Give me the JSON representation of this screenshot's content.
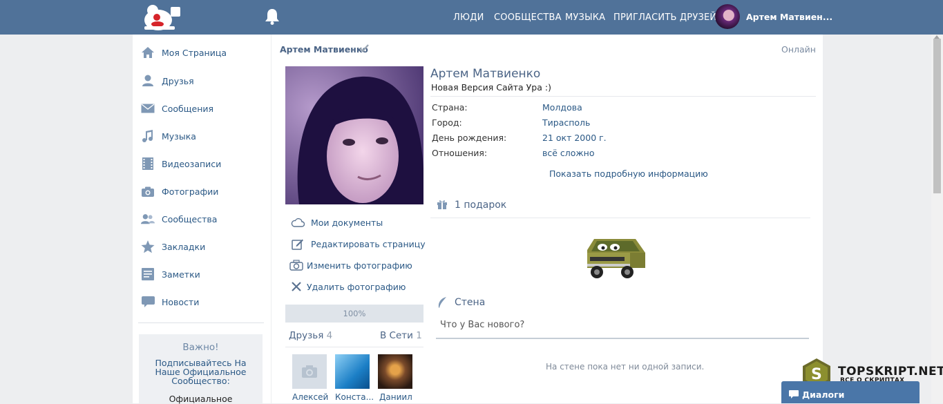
{
  "topbar": {
    "nav": [
      "ЛЮДИ",
      "СООБЩЕСТВА",
      "МУЗЫКА",
      "ПРИГЛАСИТЬ ДРУЗЕЙ"
    ],
    "username": "Артем Матвиен..."
  },
  "sidebar": {
    "items": [
      {
        "label": "Моя Страница",
        "icon": "home-icon"
      },
      {
        "label": "Друзья",
        "icon": "user-icon"
      },
      {
        "label": "Сообщения",
        "icon": "mail-icon"
      },
      {
        "label": "Музыка",
        "icon": "music-icon"
      },
      {
        "label": "Видеозаписи",
        "icon": "film-icon"
      },
      {
        "label": "Фотографии",
        "icon": "camera-icon"
      },
      {
        "label": "Сообщества",
        "icon": "users-icon"
      },
      {
        "label": "Закладки",
        "icon": "star-icon"
      },
      {
        "label": "Заметки",
        "icon": "note-icon"
      },
      {
        "label": "Новости",
        "icon": "comment-icon"
      }
    ],
    "important": {
      "title": "Важно!",
      "text": "Подписывайтесь На Наше Официальное Сообщество:",
      "text2": "Официальное"
    }
  },
  "profile": {
    "page_name": "Артем Матвиенко",
    "online": "Онлайн",
    "full_name": "Артем Матвиенко",
    "status": "Новая Версия Сайта Ура :)",
    "info": [
      {
        "key": "Страна:",
        "value": "Молдова"
      },
      {
        "key": "Город:",
        "value": "Тирасполь"
      },
      {
        "key": "День рождения:",
        "value": "21 окт 2000 г."
      },
      {
        "key": "Отношения:",
        "value": "всё сложно"
      }
    ],
    "more_info": "Показать подробную информацию",
    "actions": [
      "Мои документы",
      "Редактировать страницу",
      "Изменить фотографию",
      "Удалить фотографию"
    ],
    "progress": "100%",
    "friends_label": "Друзья",
    "friends_count": "4",
    "online_label": "В Сети",
    "online_count": "1",
    "friends": [
      "Алексей",
      "Конста...",
      "Даниил"
    ],
    "gifts": "1 подарок",
    "wall_title": "Стена",
    "wall_placeholder": "Что у Вас нового?",
    "wall_empty": "На стене пока нет ни одной записи."
  },
  "watermark": {
    "title": "TOPSKRIPT.NET",
    "subtitle": "ВСЕ О СКРИПТАХ"
  },
  "dialogs": "Диалоги",
  "colors": {
    "header": "#507299",
    "link": "#2a5885",
    "background": "#edeef0"
  }
}
